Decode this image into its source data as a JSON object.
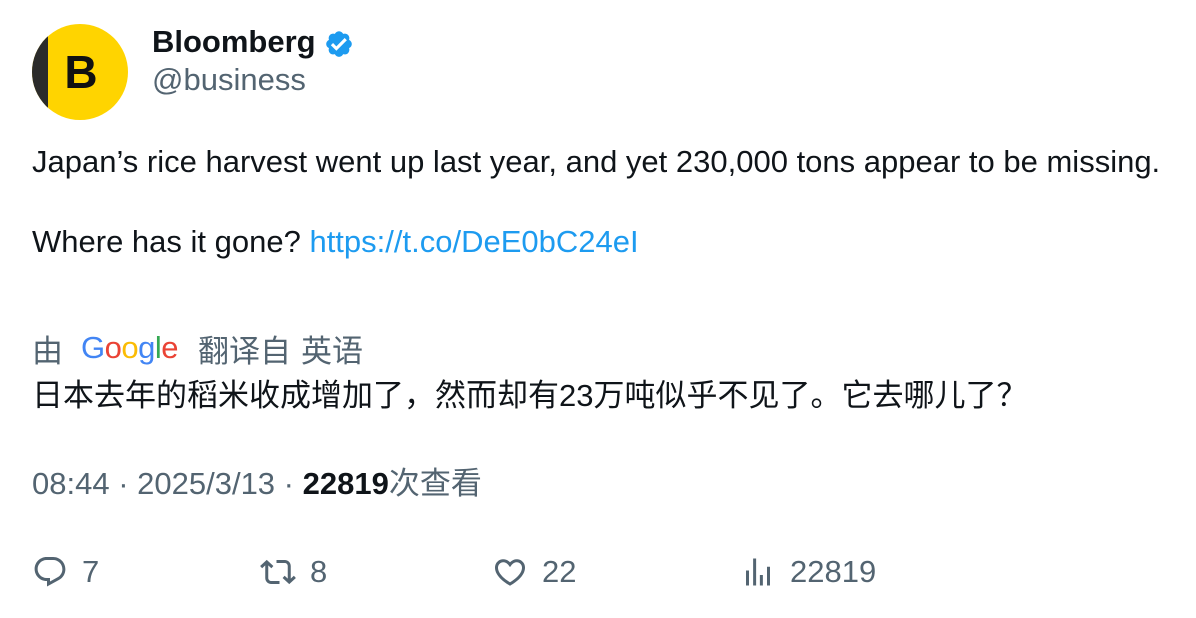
{
  "author": {
    "name": "Bloomberg",
    "handle": "@business",
    "avatar_letter": "B",
    "avatar_color": "#ffd400",
    "verified_color": "#1d9bf0"
  },
  "tweet": {
    "line1": "Japan’s rice harvest went up last year, and yet 230,000 tons appear to be missing.",
    "line2_prefix": "Where has it gone? ",
    "link_text": "https://t.co/DeE0bC24eI",
    "link_color": "#1d9bf0"
  },
  "translation": {
    "by": "由",
    "provider": "Google",
    "label": "翻译自",
    "language": "英语",
    "text": "日本去年的稻米收成增加了，然而却有23万吨似乎不见了。它去哪儿了？"
  },
  "meta": {
    "time": "08:44",
    "sep1": " · ",
    "date": "2025/3/13",
    "sep2": " · ",
    "views": "22819",
    "views_label": "次查看"
  },
  "actions": {
    "replies": "7",
    "retweets": "8",
    "likes": "22",
    "views": "22819",
    "icons": [
      "reply-icon",
      "retweet-icon",
      "like-icon",
      "views-icon"
    ]
  }
}
